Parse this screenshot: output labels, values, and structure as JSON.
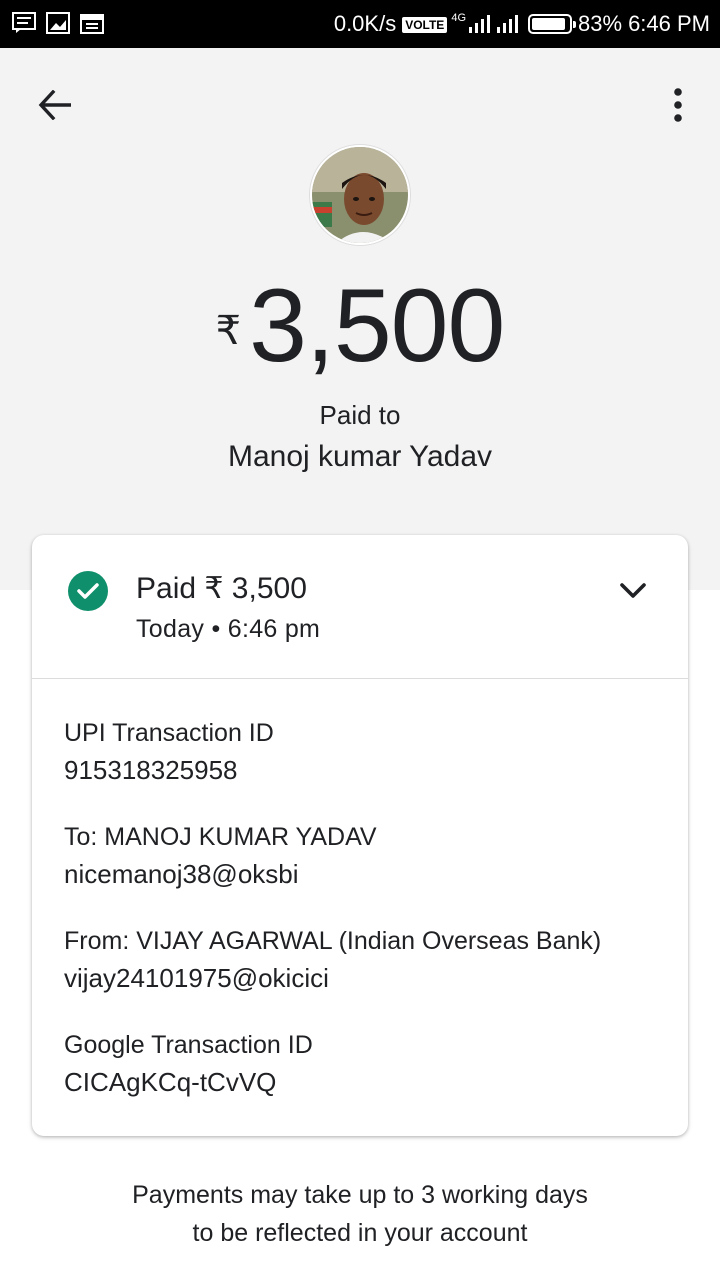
{
  "status_bar": {
    "net_speed": "0.0K/s",
    "volte": "VOLTE",
    "network": "4G",
    "battery": "83%",
    "time": "6:46 PM"
  },
  "header": {
    "currency": "₹",
    "amount": "3,500",
    "paid_to_label": "Paid to",
    "payee_name": "Manoj kumar Yadav"
  },
  "card": {
    "status_title": "Paid ₹ 3,500",
    "status_time": "Today • 6:46 pm",
    "details": [
      {
        "label": "UPI Transaction ID",
        "value": "915318325958"
      },
      {
        "label": "To: MANOJ KUMAR YADAV",
        "value": "nicemanoj38@oksbi"
      },
      {
        "label": "From: VIJAY AGARWAL (Indian Overseas Bank)",
        "value": "vijay24101975@okicici"
      },
      {
        "label": "Google Transaction ID",
        "value": "CICAgKCq-tCvVQ"
      }
    ]
  },
  "footer": {
    "line1": "Payments may take up to 3 working days",
    "line2": "to be reflected in your account"
  },
  "colors": {
    "header_bg": "#f3f3f3",
    "success_green": "#0f8f6b",
    "text": "#202124"
  }
}
